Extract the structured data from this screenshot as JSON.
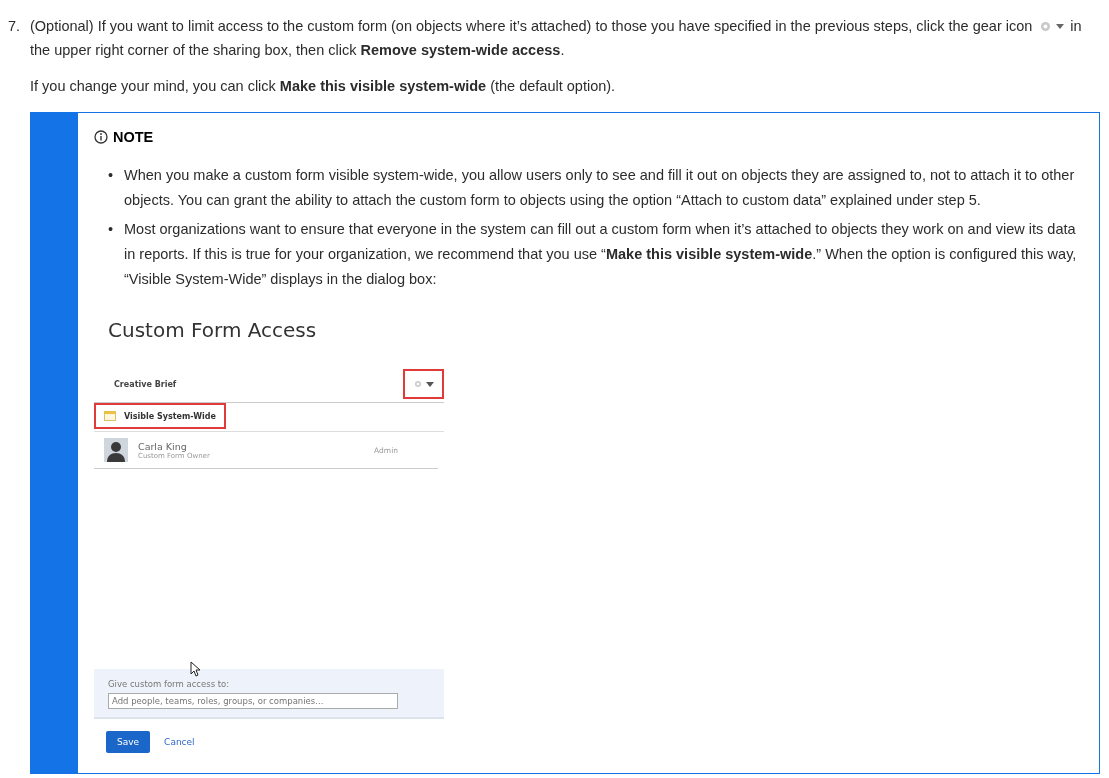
{
  "step": {
    "number": "7.",
    "text_before": "(Optional) If you want to limit access to the custom form (on objects where it’s attached) to those you have specified in the previous steps, click the gear icon",
    "text_after_icon": "in",
    "continuation": "the upper right corner of the sharing box, then click **Remove system-wide access**."
  },
  "followup": "If you change your mind, you can click **Make this visible system-wide** (the default option).",
  "note": {
    "heading": "NOTE",
    "bullets": [
      {
        "marker": "•",
        "text": "When you make a custom form visible system-wide, you allow users only to see and fill it out on objects they are assigned to, not to attach it to other objects. You can grant the ability to attach the custom form to objects using the option “Attach to custom data” explained under step 5."
      },
      {
        "marker": "•",
        "text": "Most organizations want to ensure that everyone in the system can fill out a custom form when it’s attached to objects they work on and view its data in reports. If this is true for your organization, we recommend that you use “**Make this visible system-wide**.” When the option is configured this way, “Visible System-Wide” displays in the dialog box:"
      }
    ],
    "dialog": {
      "title": "Custom Form Access",
      "object_name": "Creative Brief",
      "gear_highlighted": true,
      "badge": {
        "label": "Visible System-Wide",
        "highlighted": true
      },
      "owner": {
        "name": "Carla King",
        "role": "Custom Form Owner",
        "access": "Admin"
      },
      "share_label": "Give custom form access to:",
      "share_placeholder": "Add people, teams, roles, groups, or companies...",
      "save": "Save",
      "cancel": "Cancel"
    }
  }
}
